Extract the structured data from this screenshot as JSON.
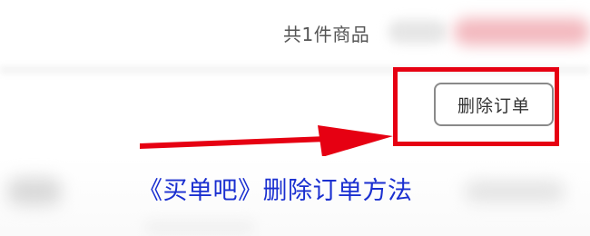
{
  "order": {
    "item_count_text": "共1件商品"
  },
  "actions": {
    "delete_order_label": "删除订单"
  },
  "caption": {
    "text": "《买单吧》删除订单方法"
  },
  "colors": {
    "highlight": "#e60012",
    "arrow": "#e60012",
    "caption": "#1a2fd0",
    "button_border": "#8a8a8a"
  },
  "icons": {
    "pointer": "arrow-right-icon"
  }
}
